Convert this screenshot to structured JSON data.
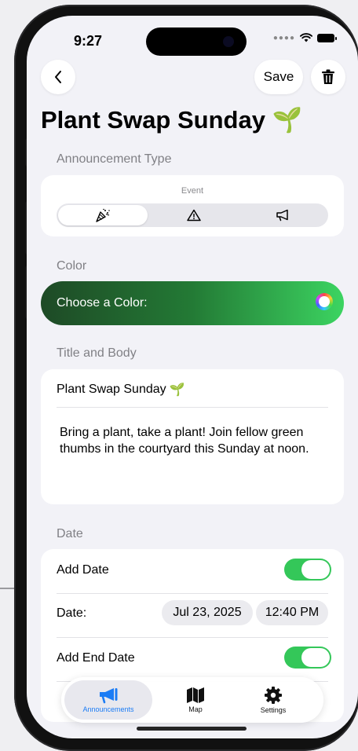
{
  "status_bar": {
    "time": "9:27"
  },
  "nav": {
    "save_label": "Save"
  },
  "page": {
    "title": "Plant Swap Sunday",
    "title_emoji": "🌱"
  },
  "announcement_type": {
    "section_label": "Announcement Type",
    "selected_caption": "Event",
    "options": [
      "Event",
      "Warning",
      "Announcement"
    ],
    "selected_index": 0
  },
  "color": {
    "section_label": "Color",
    "choose_label": "Choose a Color:",
    "gradient": [
      "#1e4a26",
      "#237a35",
      "#3cd461"
    ]
  },
  "title_body": {
    "section_label": "Title and Body",
    "title_value": "Plant Swap Sunday",
    "title_emoji": "🌱",
    "body_value": "Bring a plant, take a plant! Join fellow green thumbs in the courtyard this Sunday at noon."
  },
  "date": {
    "section_label": "Date",
    "add_date_label": "Add Date",
    "add_date_on": true,
    "date_label": "Date:",
    "date_value": "Jul 23, 2025",
    "time_value": "12:40 PM",
    "add_end_date_label": "Add End Date",
    "add_end_date_on": true
  },
  "tabbar": {
    "tabs": [
      {
        "label": "Announcements",
        "icon": "megaphone-icon",
        "active": true
      },
      {
        "label": "Map",
        "icon": "map-icon",
        "active": false
      },
      {
        "label": "Settings",
        "icon": "gear-icon",
        "active": false
      }
    ]
  },
  "colors": {
    "accent": "#1b7cf5",
    "toggle_on": "#34c759"
  }
}
